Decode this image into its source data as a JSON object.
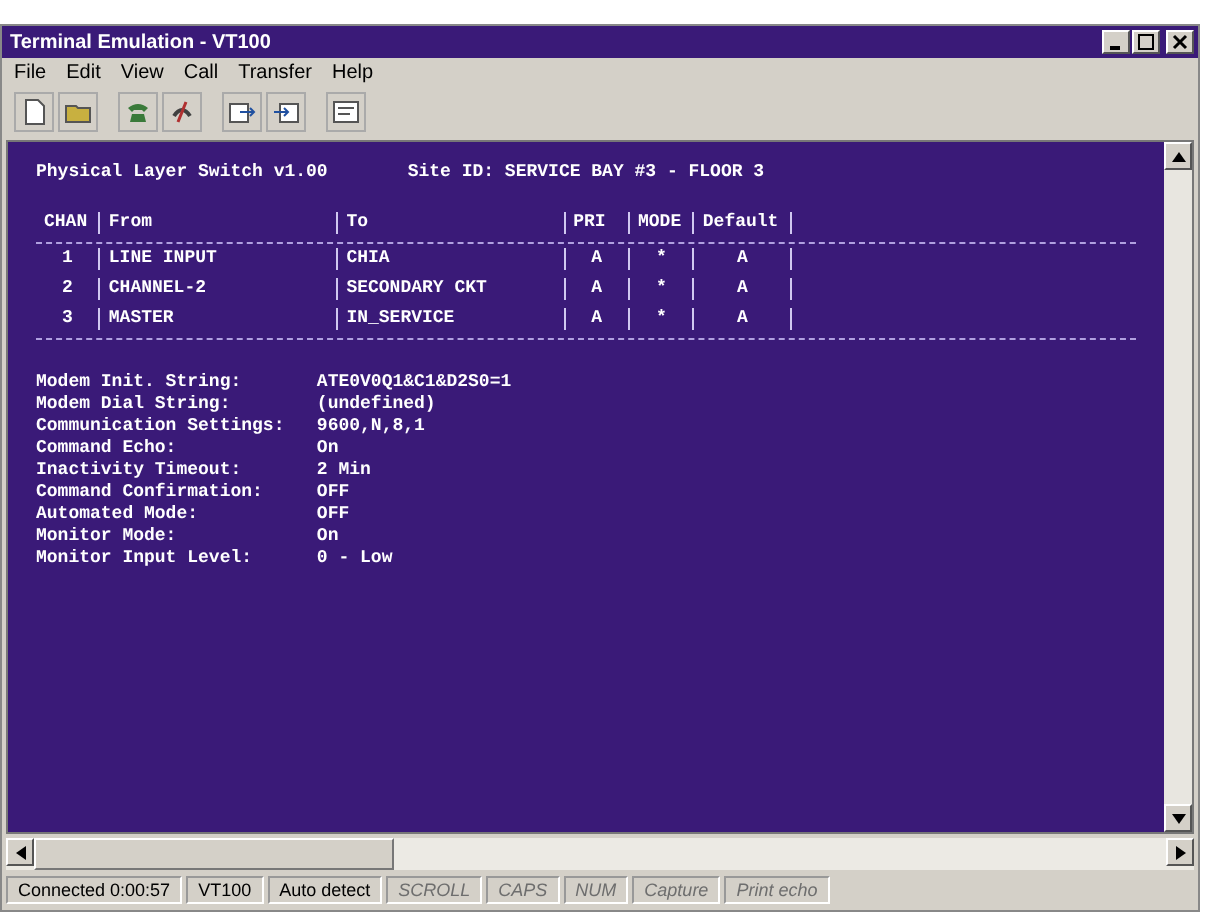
{
  "window": {
    "title": "Terminal Emulation - VT100"
  },
  "menu": [
    "File",
    "Edit",
    "View",
    "Call",
    "Transfer",
    "Help"
  ],
  "terminal": {
    "header_left": "Physical Layer Switch v1.00",
    "header_right": "Site ID: SERVICE BAY #3 - FLOOR 3",
    "table": {
      "columns": [
        "CHAN",
        "From",
        "To",
        "PRI",
        "MODE",
        "Default"
      ],
      "rows": [
        [
          "1",
          "LINE INPUT",
          "CHIA",
          "A",
          "*",
          "A"
        ],
        [
          "2",
          "CHANNEL-2",
          "SECONDARY CKT",
          "A",
          "*",
          "A"
        ],
        [
          "3",
          "MASTER",
          "IN_SERVICE",
          "A",
          "*",
          "A"
        ]
      ]
    },
    "settings": [
      {
        "label": "Modem Init. String:",
        "value": "ATE0V0Q1&C1&D2S0=1"
      },
      {
        "label": "Modem Dial String:",
        "value": "(undefined)"
      },
      {
        "label": "Communication Settings:",
        "value": "9600,N,8,1"
      },
      {
        "label": "Command Echo:",
        "value": "On"
      },
      {
        "label": "Inactivity Timeout:",
        "value": "2 Min"
      },
      {
        "label": "Command Confirmation:",
        "value": "OFF"
      },
      {
        "label": "Automated Mode:",
        "value": "OFF"
      },
      {
        "label": "Monitor Mode:",
        "value": "On"
      },
      {
        "label": "Monitor Input Level:",
        "value": "0 - Low"
      }
    ]
  },
  "status_bar": [
    {
      "text": "Connected 0:00:57",
      "disabled": false
    },
    {
      "text": "VT100",
      "disabled": false
    },
    {
      "text": "Auto detect",
      "disabled": false
    },
    {
      "text": "SCROLL",
      "disabled": true
    },
    {
      "text": "CAPS",
      "disabled": true
    },
    {
      "text": "NUM",
      "disabled": true
    },
    {
      "text": "Capture",
      "disabled": true
    },
    {
      "text": "Print echo",
      "disabled": true
    }
  ]
}
